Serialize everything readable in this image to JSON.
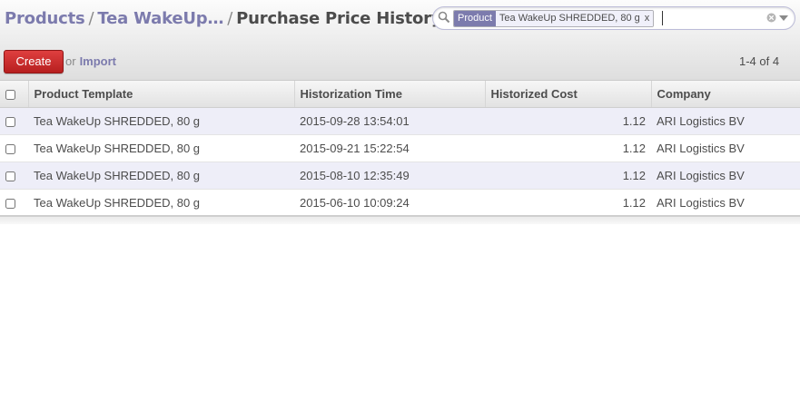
{
  "breadcrumb": {
    "products": "Products",
    "sep1": "/",
    "product": "Tea WakeUp…",
    "sep2": "/",
    "current": "Purchase Price History"
  },
  "search": {
    "facet_category": "Product",
    "facet_value": "Tea WakeUp SHREDDED, 80 g",
    "facet_remove": "x",
    "input_value": ""
  },
  "toolbar": {
    "create_label": "Create",
    "or_label": "or",
    "import_label": "Import",
    "pager": "1-4 of 4"
  },
  "table": {
    "columns": [
      "Product Template",
      "Historization Time",
      "Historized Cost",
      "Company"
    ],
    "rows": [
      {
        "product": "Tea WakeUp SHREDDED, 80 g",
        "time": "2015-09-28 13:54:01",
        "cost": "1.12",
        "company": "ARI Logistics BV"
      },
      {
        "product": "Tea WakeUp SHREDDED, 80 g",
        "time": "2015-09-21 15:22:54",
        "cost": "1.12",
        "company": "ARI Logistics BV"
      },
      {
        "product": "Tea WakeUp SHREDDED, 80 g",
        "time": "2015-08-10 12:35:49",
        "cost": "1.12",
        "company": "ARI Logistics BV"
      },
      {
        "product": "Tea WakeUp SHREDDED, 80 g",
        "time": "2015-06-10 10:09:24",
        "cost": "1.12",
        "company": "ARI Logistics BV"
      }
    ]
  },
  "colors": {
    "accent": "#7c7bad",
    "create": "#c62828",
    "row_alt": "#eeeef8"
  }
}
